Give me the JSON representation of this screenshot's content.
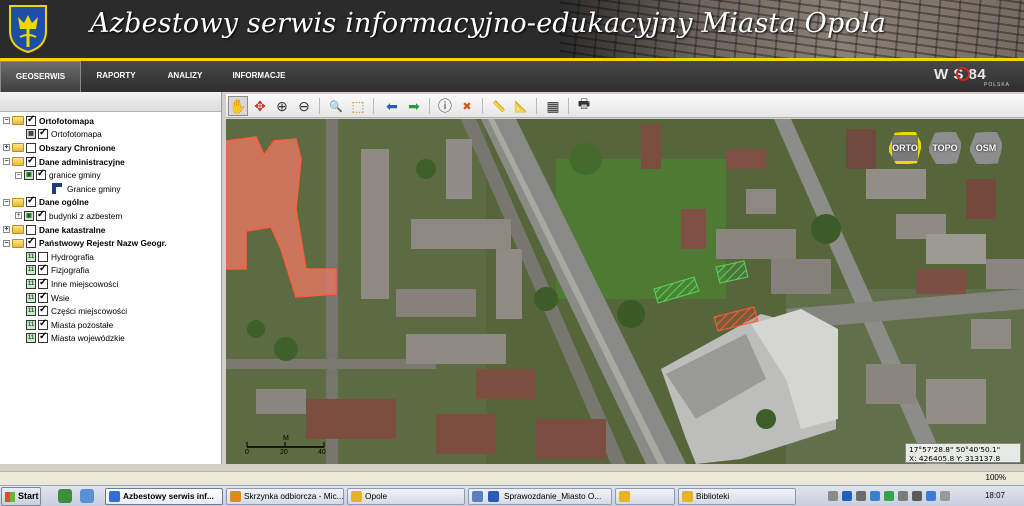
{
  "header": {
    "title": "Azbestowy serwis informacyjno-edukacyjny Miasta Opola",
    "logo_icon": "city-coat-of-arms-icon",
    "accent": "#f2d600"
  },
  "nav": {
    "tabs": [
      {
        "label": "GEOSERWIS",
        "active": true
      },
      {
        "label": "RAPORTY",
        "active": false
      },
      {
        "label": "ANALIZY",
        "active": false
      },
      {
        "label": "INFORMACJE",
        "active": false
      }
    ],
    "brand": "W  S 84",
    "brand_sub": "POLSKA"
  },
  "layers": [
    {
      "label": "Ortofotomapa",
      "type": "group",
      "bold": true,
      "checked": true
    },
    {
      "label": "Ortofotomapa",
      "type": "layer",
      "bold": false,
      "checked": true
    },
    {
      "label": "Obszary Chronione",
      "type": "group",
      "bold": true,
      "checked": false
    },
    {
      "label": "Dane administracyjne",
      "type": "group",
      "bold": true,
      "checked": true
    },
    {
      "label": "granice gminy",
      "type": "layer",
      "bold": false,
      "checked": true
    },
    {
      "label": "Granice gminy",
      "type": "legend",
      "bold": false
    },
    {
      "label": "Dane ogólne",
      "type": "group",
      "bold": true,
      "checked": true
    },
    {
      "label": "budynki z azbestem",
      "type": "layer",
      "bold": false,
      "checked": true
    },
    {
      "label": "Dane katastralne",
      "type": "group",
      "bold": true,
      "checked": false
    },
    {
      "label": "Państwowy Rejestr Nazw Geogr.",
      "type": "group",
      "bold": true,
      "checked": true
    },
    {
      "label": "Hydrografia",
      "type": "sublayer",
      "bold": false,
      "checked": false
    },
    {
      "label": "Fizjografia",
      "type": "sublayer",
      "bold": false,
      "checked": true
    },
    {
      "label": "Inne miejscowości",
      "type": "sublayer",
      "bold": false,
      "checked": true
    },
    {
      "label": "Wsie",
      "type": "sublayer",
      "bold": false,
      "checked": true
    },
    {
      "label": "Części miejscowości",
      "type": "sublayer",
      "bold": false,
      "checked": true
    },
    {
      "label": "Miasta pozostałe",
      "type": "sublayer",
      "bold": false,
      "checked": true
    },
    {
      "label": "Miasta wojewódzkie",
      "type": "sublayer",
      "bold": false,
      "checked": true
    }
  ],
  "toolbar": {
    "tools": [
      {
        "name": "pan-hand-icon",
        "glyph": "✋",
        "pressed": true
      },
      {
        "name": "full-extent-icon",
        "glyph": "✥",
        "pressed": false
      },
      {
        "name": "zoom-in-icon",
        "glyph": "⊕",
        "pressed": false
      },
      {
        "name": "zoom-out-icon",
        "glyph": "⊖",
        "pressed": false
      },
      {
        "name": "zoom-window-icon",
        "glyph": "🔍",
        "pressed": false
      },
      {
        "name": "zoom-box-icon",
        "glyph": "⬚",
        "pressed": false
      },
      {
        "name": "previous-view-icon",
        "glyph": "⬅",
        "pressed": false
      },
      {
        "name": "next-view-icon",
        "glyph": "➡",
        "pressed": false
      },
      {
        "name": "info-icon",
        "glyph": "ⓘ",
        "pressed": false
      },
      {
        "name": "clear-selection-icon",
        "glyph": "✖",
        "pressed": false
      },
      {
        "name": "measure-distance-icon",
        "glyph": "📏",
        "pressed": false
      },
      {
        "name": "measure-area-icon",
        "glyph": "📐",
        "pressed": false
      },
      {
        "name": "attribute-table-icon",
        "glyph": "▦",
        "pressed": false
      },
      {
        "name": "print-icon",
        "glyph": "🖶",
        "pressed": false
      }
    ]
  },
  "map": {
    "basemaps": [
      {
        "label": "ORTO",
        "active": true
      },
      {
        "label": "TOPO",
        "active": false
      },
      {
        "label": "OSM",
        "active": false
      }
    ],
    "scale": {
      "unit": "M",
      "ticks": [
        "0",
        "20",
        "40"
      ]
    },
    "coordinates": {
      "geo": "17°57'28.8\" 50°40'50.1\"",
      "xy": "X: 426405.8 Y: 313137.8"
    }
  },
  "statusbar": {
    "zoom": "100%"
  },
  "taskbar": {
    "start": "Start",
    "tasks": [
      {
        "label": "Azbestowy serwis inf...",
        "active": true,
        "color": "#2f6fd0"
      },
      {
        "label": "Skrzynka odbiorcza - Mic...",
        "active": false,
        "color": "#e08a18"
      },
      {
        "label": "Opole",
        "active": false,
        "color": "#e6b422"
      },
      {
        "label": "Sprawozdanie_Miasto O...",
        "active": false,
        "color": "#2a59b8"
      },
      {
        "label": "",
        "active": false,
        "color": "#e6b422"
      },
      {
        "label": "Biblioteki",
        "active": false,
        "color": "#e6b422"
      }
    ],
    "clock": "18:07"
  }
}
